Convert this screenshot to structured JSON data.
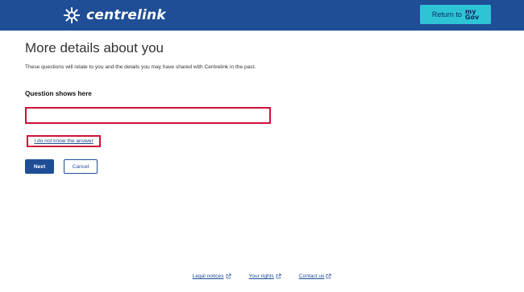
{
  "header": {
    "brand": "centrelink",
    "return_label": "Return to",
    "mygov_my": "my",
    "mygov_gov": "Gov",
    "brand_color": "#1f4e96",
    "button_color": "#2ec4d8"
  },
  "main": {
    "title": "More details about you",
    "intro": "These questions will relate to you and the details you may have shared with Centrelink in the past.",
    "question_label": "Question shows here",
    "answer_value": "",
    "dont_know_link": "I do not know the answer",
    "next_label": "Next",
    "cancel_label": "Cancel",
    "highlight_color": "#d0103a"
  },
  "footer": {
    "links": [
      {
        "label": "Legal notices",
        "icon": "external-link-icon"
      },
      {
        "label": "Your rights",
        "icon": "external-link-icon"
      },
      {
        "label": "Contact us",
        "icon": "external-link-icon"
      }
    ]
  }
}
